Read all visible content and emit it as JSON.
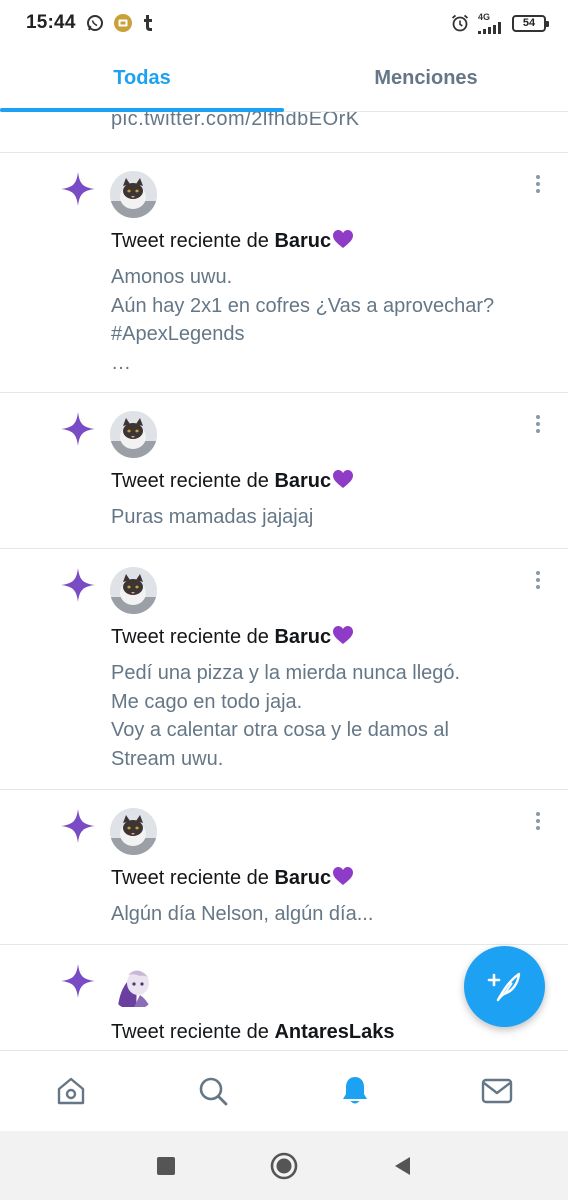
{
  "status_bar": {
    "time": "15:44",
    "network": "4G",
    "battery": "54",
    "left_icons": [
      "whatsapp-icon",
      "media-icon",
      "tumblr-icon"
    ],
    "right_icons": [
      "alarm-icon",
      "signal-icon",
      "battery-icon"
    ]
  },
  "tabs": [
    {
      "label": "Todas",
      "active": true
    },
    {
      "label": "Menciones",
      "active": false
    }
  ],
  "feed": {
    "partial_link": "pic.twitter.com/2lfhdbEOrK",
    "notifications": [
      {
        "title_prefix": "Tweet reciente de ",
        "user": "Baruc",
        "user_emoji": "purple-heart",
        "text": "Amonos uwu.\nAún hay 2x1 en cofres ¿Vas a aprovechar?\n#ApexLegends\n…"
      },
      {
        "title_prefix": "Tweet reciente de ",
        "user": "Baruc",
        "user_emoji": "purple-heart",
        "text": "Puras mamadas jajajaj"
      },
      {
        "title_prefix": "Tweet reciente de ",
        "user": "Baruc",
        "user_emoji": "purple-heart",
        "text": "Pedí una pizza y la mierda nunca llegó.\nMe cago en todo jaja.\nVoy a calentar otra cosa y le damos al\nStream uwu."
      },
      {
        "title_prefix": "Tweet reciente de ",
        "user": "Baruc",
        "user_emoji": "purple-heart",
        "text": "Algún día Nelson, algún día..."
      },
      {
        "title_prefix": "Tweet reciente de ",
        "user": "AntaresLaks",
        "user_emoji": "",
        "text": ""
      }
    ]
  },
  "fab": {
    "icon": "compose-tweet-icon"
  },
  "bottom_nav": [
    {
      "icon": "home-icon",
      "active": false
    },
    {
      "icon": "search-icon",
      "active": false
    },
    {
      "icon": "notifications-bell-icon",
      "active": true
    },
    {
      "icon": "messages-envelope-icon",
      "active": false
    }
  ],
  "system_nav": [
    "recents-square-icon",
    "home-circle-icon",
    "back-triangle-icon"
  ],
  "colors": {
    "accent": "#1da1f2",
    "sparkle": "#794bc4",
    "secondary_text": "#657786",
    "primary_text": "#14171a",
    "divider": "#e1e8ed",
    "icon_gray": "#657786"
  }
}
